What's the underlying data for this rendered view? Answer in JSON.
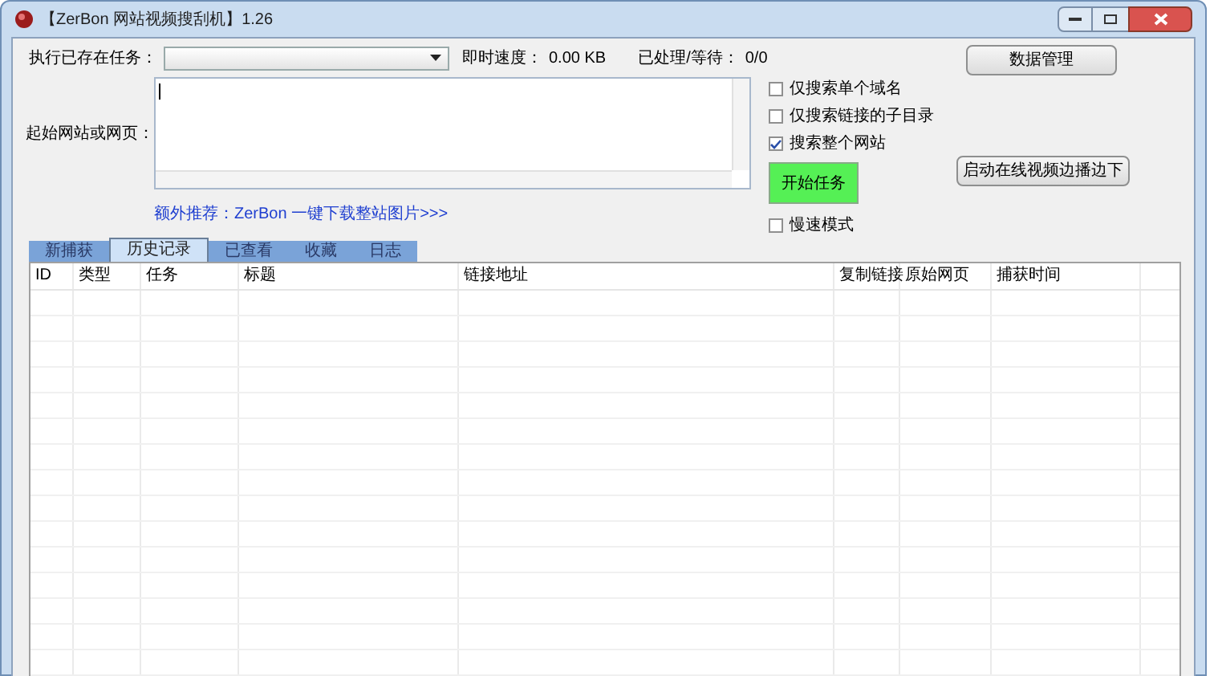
{
  "window": {
    "title": "【ZerBon 网站视频搜刮机】1.26"
  },
  "task_label": "执行已存在任务：",
  "speed": {
    "label": "即时速度：",
    "value": "0.00 KB"
  },
  "progress": {
    "label": "已处理/等待：",
    "value": "0/0"
  },
  "start_url": {
    "label": "起始网站或网页："
  },
  "options": [
    {
      "label": "仅搜索单个域名",
      "checked": false
    },
    {
      "label": "仅搜索链接的子目录",
      "checked": false
    },
    {
      "label": "搜索整个网站",
      "checked": true
    }
  ],
  "slow_mode": {
    "label": "慢速模式",
    "checked": false
  },
  "buttons": {
    "data_manage": "数据管理",
    "start": "开始任务",
    "online_video": "启动在线视频边播边下"
  },
  "promo_link": "额外推荐：ZerBon 一键下载整站图片>>>",
  "tabs": [
    {
      "label": "新捕获",
      "selected": false
    },
    {
      "label": "历史记录",
      "selected": true
    },
    {
      "label": "已查看",
      "selected": false
    },
    {
      "label": "收藏",
      "selected": false
    },
    {
      "label": "日志",
      "selected": false
    }
  ],
  "table": {
    "columns": [
      "ID",
      "类型",
      "任务",
      "标题",
      "链接地址",
      "复制链接",
      "原始网页",
      "捕获时间"
    ]
  }
}
